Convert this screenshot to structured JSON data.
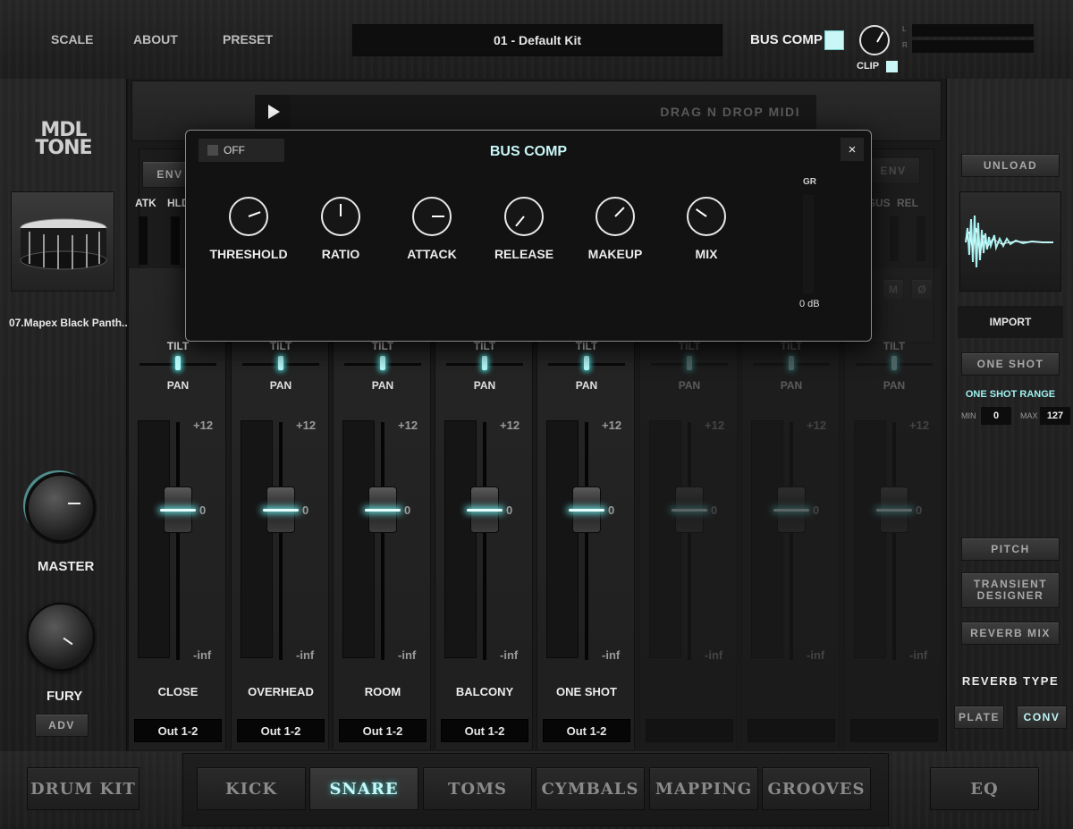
{
  "top": {
    "nav": [
      "SCALE",
      "ABOUT",
      "PRESET"
    ],
    "preset_name": "01 - Default Kit",
    "bus_comp_label": "BUS COMP",
    "clip_label": "CLIP",
    "meter_l": "L",
    "meter_r": "R"
  },
  "left": {
    "logo_line1": "MDL",
    "logo_line2": "TONE",
    "instrument_name": "07.Mapex Black Panth...",
    "master_label": "MASTER",
    "fury_label": "FURY",
    "adv_label": "ADV"
  },
  "midi": {
    "drag_label": "DRAG N DROP MIDI"
  },
  "envelope": {
    "env_label": "ENV",
    "atk": "ATK",
    "hld": "HLD",
    "sus": "SUS",
    "rel": "REL",
    "solo": "S",
    "mute": "M",
    "phase": "Ø"
  },
  "strips": [
    {
      "name": "CLOSE",
      "output": "Out 1-2",
      "tilt": "TILT",
      "pan": "PAN",
      "plus": "+12",
      "zero": "0",
      "inf": "-inf"
    },
    {
      "name": "OVERHEAD",
      "output": "Out 1-2",
      "tilt": "TILT",
      "pan": "PAN",
      "plus": "+12",
      "zero": "0",
      "inf": "-inf"
    },
    {
      "name": "ROOM",
      "output": "Out 1-2",
      "tilt": "TILT",
      "pan": "PAN",
      "plus": "+12",
      "zero": "0",
      "inf": "-inf"
    },
    {
      "name": "BALCONY",
      "output": "Out 1-2",
      "tilt": "TILT",
      "pan": "PAN",
      "plus": "+12",
      "zero": "0",
      "inf": "-inf"
    },
    {
      "name": "ONE SHOT",
      "output": "Out 1-2",
      "tilt": "TILT",
      "pan": "PAN",
      "plus": "+12",
      "zero": "0",
      "inf": "-inf"
    },
    {
      "name": "",
      "output": "",
      "tilt": "TILT",
      "pan": "PAN",
      "plus": "+12",
      "zero": "0",
      "inf": "-inf"
    },
    {
      "name": "",
      "output": "",
      "tilt": "TILT",
      "pan": "PAN",
      "plus": "+12",
      "zero": "0",
      "inf": "-inf"
    },
    {
      "name": "",
      "output": "",
      "tilt": "TILT",
      "pan": "PAN",
      "plus": "+12",
      "zero": "0",
      "inf": "-inf"
    }
  ],
  "modal": {
    "off_label": "OFF",
    "title": "BUS COMP",
    "close": "×",
    "gr_label": "GR",
    "db_label": "0 dB",
    "knobs": [
      "THRESHOLD",
      "RATIO",
      "ATTACK",
      "RELEASE",
      "MAKEUP",
      "MIX"
    ]
  },
  "right": {
    "unload": "UNLOAD",
    "import": "IMPORT",
    "one_shot": "ONE SHOT",
    "range_label": "ONE SHOT RANGE",
    "min_label": "MIN",
    "min_value": "0",
    "max_label": "MAX",
    "max_value": "127",
    "pitch": "PITCH",
    "transient_1": "TRANSIENT",
    "transient_2": "DESIGNER",
    "reverb_mix": "REVERB MIX",
    "reverb_type": "REVERB TYPE",
    "plate": "PLATE",
    "conv": "CONV"
  },
  "bottom": {
    "drum_kit": "DRUM KIT",
    "tabs": [
      "KICK",
      "SNARE",
      "TOMS",
      "CYMBALS",
      "MAPPING",
      "GROOVES"
    ],
    "eq": "EQ"
  },
  "colors": {
    "accent": "#bff6f6",
    "glow": "#6ef0f0",
    "panel": "#1e1e1e"
  }
}
